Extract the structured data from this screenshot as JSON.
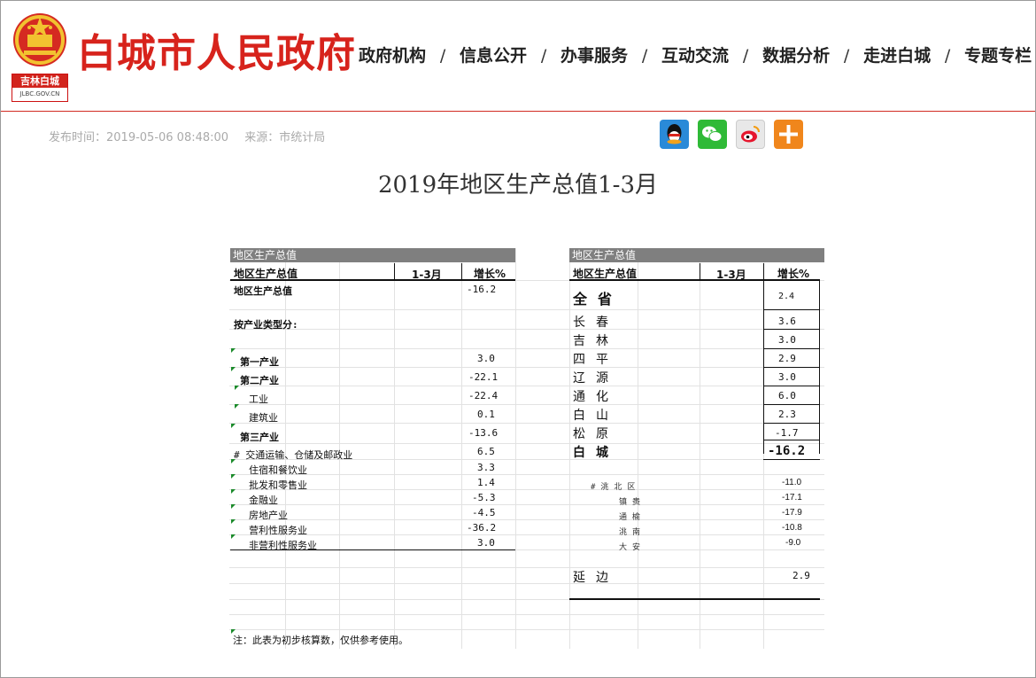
{
  "header": {
    "emblem_badge": "吉林白城",
    "emblem_domain": "JLBC.GOV.CN",
    "site_title": "白城市人民政府",
    "nav": [
      "政府机构",
      "信息公开",
      "办事服务",
      "互动交流",
      "数据分析",
      "走进白城",
      "专题专栏"
    ],
    "nav_separator": "/"
  },
  "meta": {
    "publish_time": "发布时间：2019-05-06 08:48:00",
    "source": "来源：市统计局"
  },
  "share_icons": [
    "qq-icon",
    "wechat-icon",
    "weibo-icon",
    "plus-icon"
  ],
  "doc_title": "2019年地区生产总值1-3月",
  "left_table": {
    "banner": "地区生产总值",
    "col_name": "地区生产总值",
    "col_period": "1-3月",
    "col_growth": "增长%",
    "rows": [
      {
        "label": "地区生产总值",
        "value": "-16.2"
      },
      {
        "label": "按产业类型分:",
        "value": ""
      },
      {
        "label": "第一产业",
        "value": "3.0"
      },
      {
        "label": "第二产业",
        "value": "-22.1"
      },
      {
        "label": "工业",
        "value": "-22.4"
      },
      {
        "label": "建筑业",
        "value": "0.1"
      },
      {
        "label": "第三产业",
        "value": "-13.6"
      },
      {
        "label": "# 交通运输、仓储及邮政业",
        "value": "6.5"
      },
      {
        "label": "住宿和餐饮业",
        "value": "3.3"
      },
      {
        "label": "批发和零售业",
        "value": "1.4"
      },
      {
        "label": "金融业",
        "value": "-5.3"
      },
      {
        "label": "房地产业",
        "value": "-4.5"
      },
      {
        "label": "营利性服务业",
        "value": "-36.2"
      },
      {
        "label": "非营利性服务业",
        "value": "3.0"
      }
    ],
    "note": "注：此表为初步核算数，仅供参考使用。"
  },
  "right_table": {
    "banner": "地区生产总值",
    "col_name": "地区生产总值",
    "col_period": "1-3月",
    "col_growth": "增长%",
    "rows": [
      {
        "label": "全省",
        "value": "2.4"
      },
      {
        "label": "长春",
        "value": "3.6"
      },
      {
        "label": "吉林",
        "value": "3.0"
      },
      {
        "label": "四平",
        "value": "2.9"
      },
      {
        "label": "辽源",
        "value": "3.0"
      },
      {
        "label": "通化",
        "value": "6.0"
      },
      {
        "label": "白山",
        "value": "2.3"
      },
      {
        "label": "松原",
        "value": "-1.7"
      },
      {
        "label": "白城",
        "value": "-16.2"
      }
    ],
    "sub_rows": [
      {
        "label": "#洮北区",
        "value": "-11.0"
      },
      {
        "label": "镇赉",
        "value": "-17.1"
      },
      {
        "label": "通榆",
        "value": "-17.9"
      },
      {
        "label": "洮南",
        "value": "-10.8"
      },
      {
        "label": "大安",
        "value": "-9.0"
      }
    ],
    "yanbian": {
      "label": "延边",
      "value": "2.9"
    }
  }
}
